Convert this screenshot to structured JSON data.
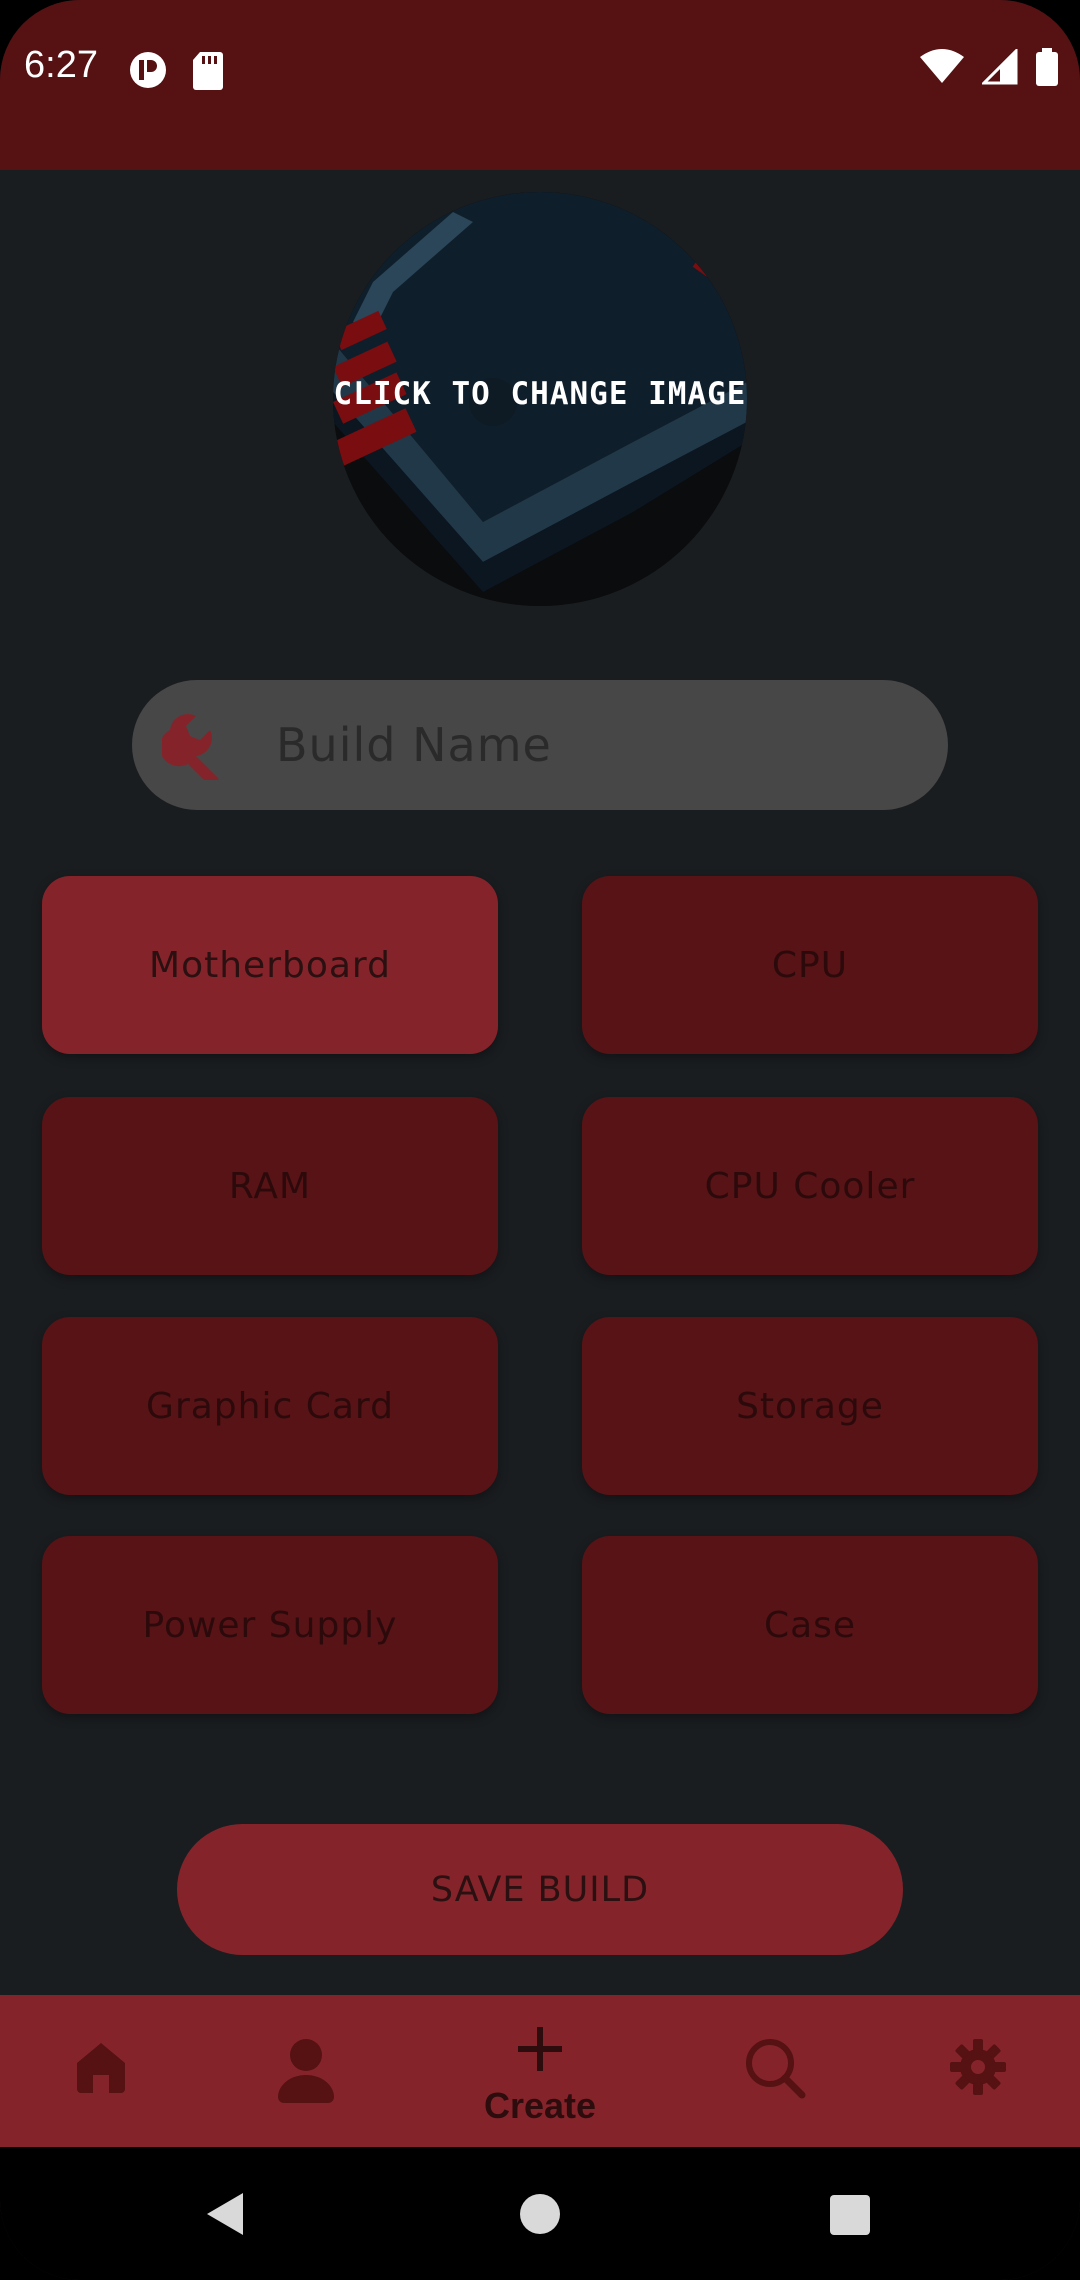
{
  "status_bar": {
    "time": "6:27",
    "left_icons": [
      "notification-app-icon",
      "sd-card-icon"
    ],
    "right_icons": [
      "wifi-icon",
      "cell-signal-icon",
      "battery-icon"
    ]
  },
  "image_picker": {
    "caption": "CLICK TO CHANGE IMAGE"
  },
  "build_name": {
    "placeholder": "Build Name",
    "value": "",
    "icon": "wrench-icon"
  },
  "components": [
    {
      "label": "Motherboard",
      "active": true
    },
    {
      "label": "CPU",
      "active": false
    },
    {
      "label": "RAM",
      "active": false
    },
    {
      "label": "CPU Cooler",
      "active": false
    },
    {
      "label": "Graphic Card",
      "active": false
    },
    {
      "label": "Storage",
      "active": false
    },
    {
      "label": "Power Supply",
      "active": false
    },
    {
      "label": "Case",
      "active": false
    }
  ],
  "save_button": {
    "label": "SAVE BUILD"
  },
  "bottom_nav": {
    "items": [
      {
        "icon": "home-icon",
        "label": ""
      },
      {
        "icon": "profile-icon",
        "label": ""
      },
      {
        "icon": "plus-icon",
        "label": "Create"
      },
      {
        "icon": "search-icon",
        "label": ""
      },
      {
        "icon": "gear-icon",
        "label": ""
      }
    ],
    "selected": "Create"
  },
  "system_nav": [
    "back-icon",
    "home-circle-icon",
    "recents-icon"
  ],
  "colors": {
    "header": "#561113",
    "background": "#1a1d20",
    "accent": "#84242a",
    "tile": "#581316",
    "input": "#474747"
  }
}
